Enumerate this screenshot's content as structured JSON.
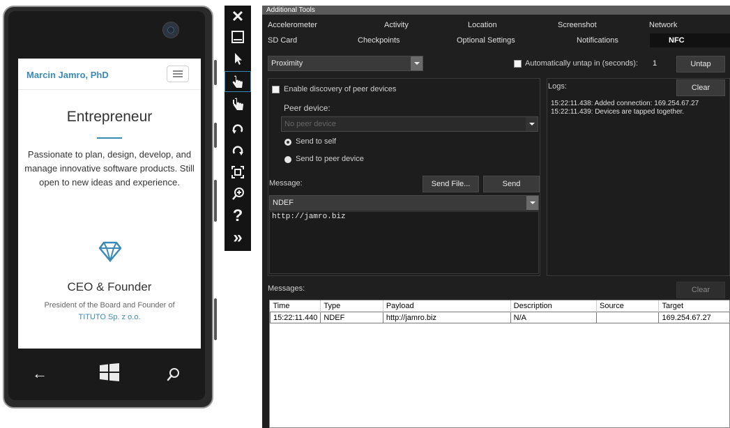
{
  "phone": {
    "site_title": "Marcin Jamro, PhD",
    "heading": "Entrepreneur",
    "intro": "Passionate to plan, design, develop, and manage innovative software products. Still open to new ideas and experience.",
    "ceo_title": "CEO & Founder",
    "president_line": "President of the Board and Founder of",
    "company_link": "TITUTO Sp. z o.o.",
    "nav_icons": [
      "back-arrow-icon",
      "windows-start-icon",
      "search-icon"
    ]
  },
  "toolbar": {
    "icons": [
      "close-icon",
      "minimize-icon",
      "pointer-icon",
      "single-touch-icon",
      "multi-touch-icon",
      "rotate-left-icon",
      "rotate-right-icon",
      "fit-to-screen-icon",
      "zoom-icon",
      "help-icon",
      "more-tools-icon"
    ],
    "close_glyph": "✕",
    "help_glyph": "?",
    "more_glyph": "»"
  },
  "tools": {
    "title": "Additional Tools",
    "tabs_row1": [
      "Accelerometer",
      "Activity",
      "Location",
      "Screenshot",
      "Network"
    ],
    "tabs_row2": [
      "SD Card",
      "Checkpoints",
      "Optional Settings",
      "Notifications",
      "NFC"
    ],
    "active_tab": "NFC",
    "mode_select": "Proximity",
    "auto_untap_label": "Automatically untap in (seconds):",
    "auto_untap_value": "1",
    "untap_button": "Untap",
    "enable_discovery_label": "Enable discovery of peer devices",
    "peer_device_label": "Peer device:",
    "peer_device_select": "No peer device",
    "send_to_self": "Send to self",
    "send_to_peer": "Send to peer device",
    "message_label": "Message:",
    "send_file_button": "Send File...",
    "send_button": "Send",
    "message_type_select": "NDEF",
    "message_text": "http://jamro.biz",
    "logs_label": "Logs:",
    "logs_clear_button": "Clear",
    "log_lines": [
      "15:22:11.438: Added connection: 169.254.67.27",
      "15:22:11.439: Devices are tapped together."
    ],
    "messages_label": "Messages:",
    "messages_clear_button": "Clear",
    "table_headers": [
      "Time",
      "Type",
      "Payload",
      "Description",
      "Source",
      "Target"
    ],
    "table_rows": [
      [
        "15:22:11.440",
        "NDEF",
        "http://jamro.biz",
        "N/A",
        "",
        "169.254.67.27"
      ]
    ]
  },
  "colors": {
    "accent_blue": "#3a8ab8",
    "tools_bg": "#1f1f1f",
    "titlebar_bg": "#5a5a5a",
    "toolbar_bg": "#141414"
  }
}
